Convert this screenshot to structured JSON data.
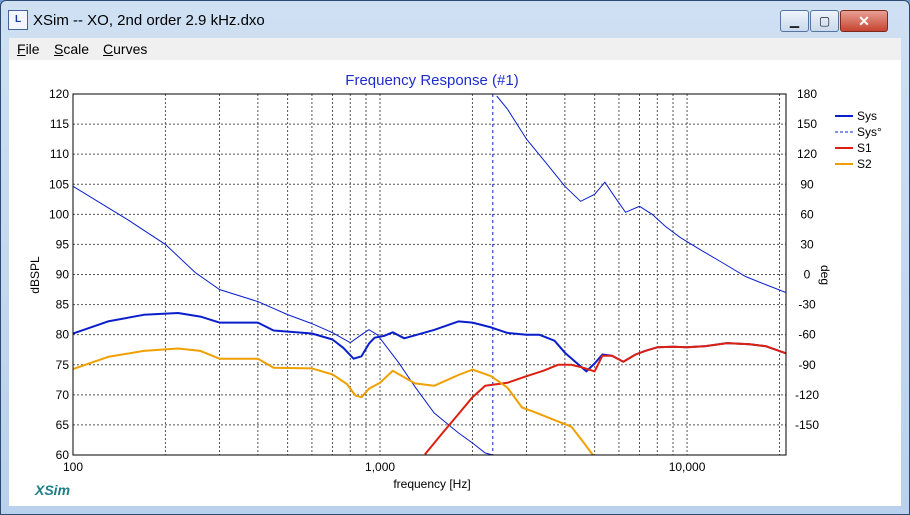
{
  "window": {
    "title": "XSim -- XO, 2nd order 2.9 kHz.dxo",
    "app_icon_glyph": "L",
    "buttons": {
      "minimize": "▁",
      "maximize": "▢",
      "close": "✕"
    }
  },
  "menu": [
    {
      "label": "File"
    },
    {
      "label": "Scale"
    },
    {
      "label": "Curves"
    }
  ],
  "brand_label": "XSim",
  "colors": {
    "sys": "#0a1fcc",
    "sys_phase": "#0a1fcc",
    "s1": "#dd2010",
    "s2": "#f0a000",
    "title": "#1f2dcc",
    "grid": "#555555",
    "brand": "#1a7f86"
  },
  "chart_data": {
    "type": "line",
    "title": "Frequency Response (#1)",
    "xlabel": "frequency [Hz]",
    "ylabel": "dBSPL",
    "y2label": "deg",
    "x_scale": "log",
    "xlim": [
      100,
      21000
    ],
    "ylim": [
      60,
      120
    ],
    "y2lim": [
      -180,
      180
    ],
    "x_ticks": [
      100,
      1000,
      10000
    ],
    "x_tick_labels": [
      "100",
      "1,000",
      "10,000"
    ],
    "y_ticks": [
      60,
      65,
      70,
      75,
      80,
      85,
      90,
      95,
      100,
      105,
      110,
      115,
      120
    ],
    "y2_ticks": [
      -150,
      -120,
      -90,
      -60,
      -30,
      0,
      30,
      60,
      90,
      120,
      150,
      180
    ],
    "grid": true,
    "legend": "right",
    "series": [
      {
        "name": "Sys",
        "axis": "left",
        "style": "solid",
        "x": [
          100,
          130,
          170,
          220,
          260,
          300,
          400,
          450,
          600,
          700,
          760,
          820,
          870,
          920,
          960,
          1030,
          1100,
          1200,
          1500,
          1800,
          2000,
          2300,
          2600,
          3000,
          3300,
          3700,
          4000,
          4300,
          4700,
          5000,
          5300,
          5700,
          6200,
          6800,
          7300,
          8000,
          9000,
          10000,
          11500,
          13500,
          16000,
          18000,
          21000
        ],
        "y": [
          80.2,
          82.2,
          83.3,
          83.6,
          83.0,
          82.0,
          82.0,
          80.7,
          80.2,
          79.2,
          77.8,
          76.0,
          76.4,
          78.5,
          79.5,
          79.8,
          80.4,
          79.4,
          80.8,
          82.2,
          82.0,
          81.2,
          80.3,
          80.0,
          80.0,
          79.0,
          77.0,
          75.6,
          73.9,
          75.2,
          76.7,
          76.5,
          75.5,
          76.7,
          77.3,
          77.9,
          78.0,
          77.9,
          78.1,
          78.6,
          78.4,
          78.1,
          76.9
        ]
      },
      {
        "name": "Sys°",
        "axis": "right",
        "style": "thin",
        "x": [
          100,
          150,
          200,
          250,
          300,
          400,
          500,
          600,
          700,
          800,
          870,
          920,
          980,
          1050,
          1150,
          1300,
          1500,
          1800,
          2000,
          2200,
          2330,
          2400,
          2600,
          3000,
          3500,
          4000,
          4500,
          5000,
          5400,
          5800,
          6300,
          7000,
          7700,
          8500,
          9500,
          11000,
          13000,
          15500,
          18000,
          21000
        ],
        "y": [
          88,
          55,
          30,
          2,
          -15,
          -27,
          -40,
          -49,
          -58,
          -68,
          -60,
          -55,
          -60,
          -72,
          -88,
          -112,
          -138,
          -158,
          -168,
          -178,
          -180,
          178,
          165,
          135,
          110,
          88,
          73,
          80,
          92,
          78,
          62,
          68,
          60,
          48,
          37,
          25,
          12,
          -2,
          -10,
          -18
        ]
      },
      {
        "name": "S1",
        "axis": "left",
        "style": "solid",
        "x": [
          1400,
          1600,
          1800,
          2000,
          2200,
          2600,
          3000,
          3400,
          3800,
          4200,
          4600,
          5000,
          5300,
          5700,
          6200,
          6800,
          7300,
          8000,
          9000,
          10000,
          11500,
          13500,
          16000,
          18000,
          21000
        ],
        "y": [
          60.1,
          63.7,
          66.8,
          69.6,
          71.5,
          72.0,
          73.1,
          74.0,
          75.0,
          75.0,
          74.5,
          73.9,
          76.5,
          76.5,
          75.5,
          76.7,
          77.3,
          77.9,
          78.0,
          77.9,
          78.1,
          78.6,
          78.4,
          78.1,
          76.9
        ]
      },
      {
        "name": "S2",
        "axis": "left",
        "style": "solid",
        "x": [
          100,
          130,
          170,
          220,
          260,
          300,
          400,
          450,
          600,
          700,
          780,
          830,
          870,
          920,
          1000,
          1100,
          1300,
          1500,
          1800,
          2000,
          2300,
          2600,
          2900,
          3200,
          3700,
          4200,
          4600,
          5000
        ],
        "y": [
          74.3,
          76.3,
          77.3,
          77.7,
          77.3,
          76.0,
          76.0,
          74.5,
          74.4,
          73.4,
          71.8,
          69.9,
          69.6,
          71.0,
          72.0,
          74.0,
          71.9,
          71.5,
          73.3,
          74.2,
          73.1,
          71.2,
          67.9,
          67.1,
          65.8,
          64.7,
          62.1,
          59.6
        ]
      }
    ]
  }
}
